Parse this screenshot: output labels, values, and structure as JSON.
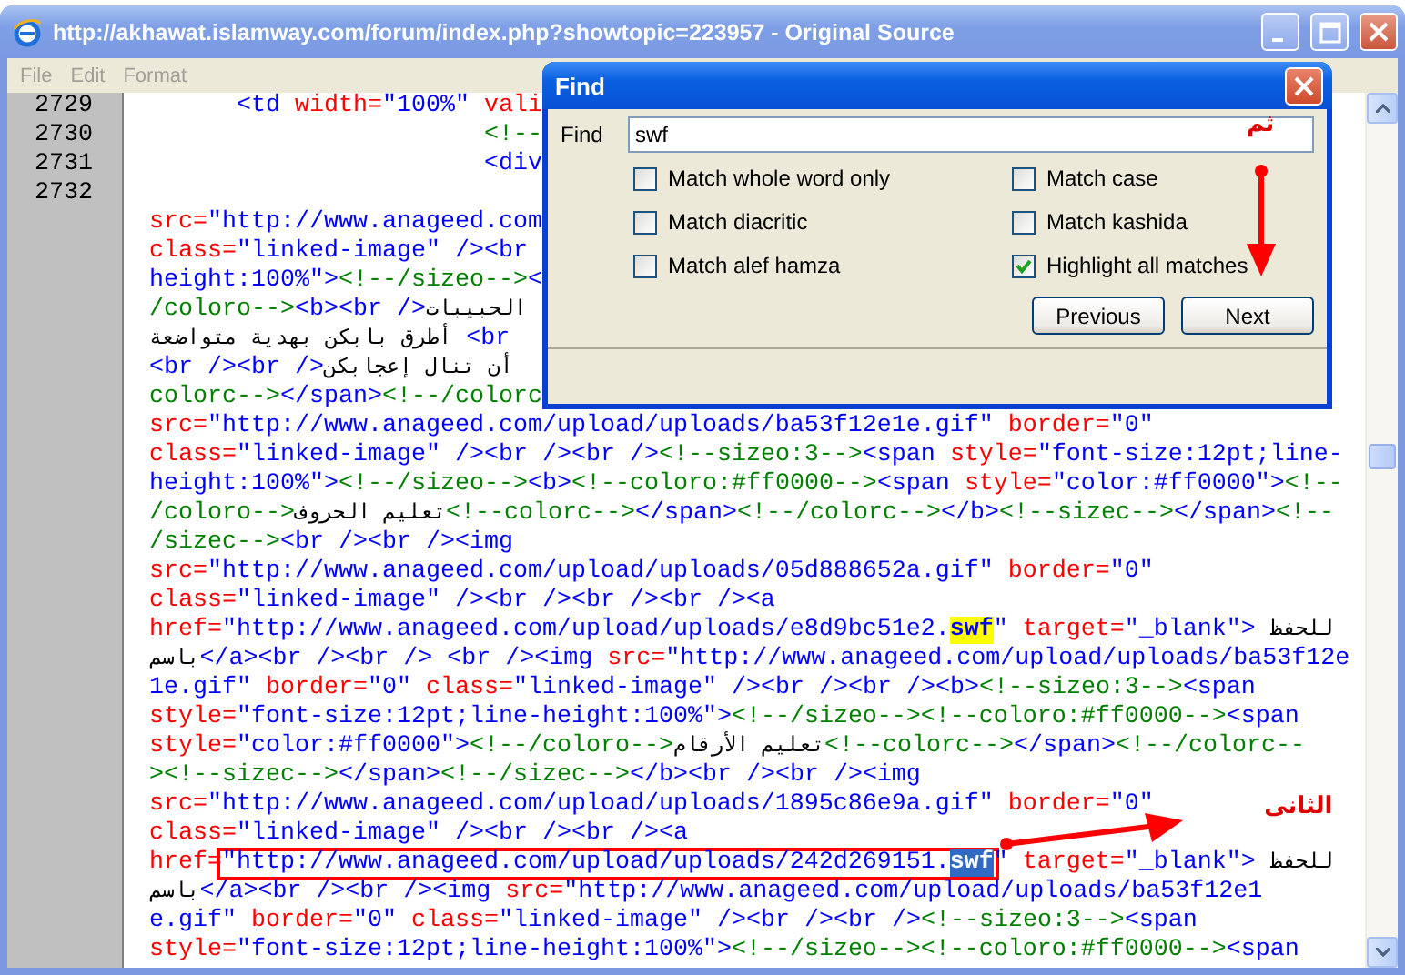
{
  "window": {
    "title": "http://akhawat.islamway.com/forum/index.php?showtopic=223957 - Original Source",
    "menu": [
      "File",
      "Edit",
      "Format"
    ]
  },
  "source": {
    "box_note": "الثانى",
    "lines": [
      {
        "number": "2729",
        "segments": [
          {
            "kind": "markup",
            "text": "      <td "
          },
          {
            "kind": "attr",
            "text": "width="
          },
          {
            "kind": "markup",
            "text": "\"100%\" "
          },
          {
            "kind": "attr",
            "text": "vali"
          }
        ]
      },
      {
        "number": "2730",
        "segments": [
          {
            "kind": "comment",
            "text": "                       <!--"
          }
        ]
      },
      {
        "number": "2731",
        "segments": [
          {
            "kind": "markup",
            "text": "                       <div"
          }
        ]
      },
      {
        "number": "2732"
      },
      {
        "segments": [
          {
            "kind": "attr",
            "text": "src="
          },
          {
            "kind": "markup",
            "text": "\"http://www.anageed.com"
          }
        ]
      },
      {
        "segments": [
          {
            "kind": "attr",
            "text": "class="
          },
          {
            "kind": "markup",
            "text": "\"linked-image\" /><br"
          }
        ]
      },
      {
        "segments": [
          {
            "kind": "markup",
            "text": "height:100%\">"
          },
          {
            "kind": "comment",
            "text": "<!--/sizeo-->"
          },
          {
            "kind": "markup",
            "text": "<"
          }
        ]
      },
      {
        "segments": [
          {
            "kind": "comment",
            "text": "/coloro-->"
          },
          {
            "kind": "markup",
            "text": "<b><br />"
          },
          {
            "kind": "text",
            "text": "الحبيبات"
          }
        ]
      },
      {
        "segments": [
          {
            "kind": "text",
            "text": "أطرق بابكن بهدية متواضعة"
          },
          {
            "kind": "markup",
            "text": " <br"
          }
        ]
      },
      {
        "segments": [
          {
            "kind": "markup",
            "text": "<br /><br />"
          },
          {
            "kind": "text",
            "text": "أن تنال إعجابكن"
          }
        ]
      },
      {
        "segments": [
          {
            "kind": "comment",
            "text": "colorc-->"
          },
          {
            "kind": "markup",
            "text": "</span>"
          },
          {
            "kind": "comment",
            "text": "<!--/colorc"
          }
        ]
      },
      {
        "segments": [
          {
            "kind": "attr",
            "text": "src="
          },
          {
            "kind": "markup",
            "text": "\"http://www.anageed.com/upload/uploads/ba53f12e1e.gif\" "
          },
          {
            "kind": "attr",
            "text": "border="
          },
          {
            "kind": "markup",
            "text": "\"0\""
          }
        ]
      },
      {
        "segments": [
          {
            "kind": "attr",
            "text": "class="
          },
          {
            "kind": "markup",
            "text": "\"linked-image\" /><br /><br />"
          },
          {
            "kind": "comment",
            "text": "<!--sizeo:3-->"
          },
          {
            "kind": "markup",
            "text": "<span "
          },
          {
            "kind": "attr",
            "text": "style="
          },
          {
            "kind": "markup",
            "text": "\"font-size:12pt;line-"
          }
        ]
      },
      {
        "segments": [
          {
            "kind": "markup",
            "text": "height:100%\">"
          },
          {
            "kind": "comment",
            "text": "<!--/sizeo-->"
          },
          {
            "kind": "markup",
            "text": "<b>"
          },
          {
            "kind": "comment",
            "text": "<!--coloro:#ff0000-->"
          },
          {
            "kind": "markup",
            "text": "<span "
          },
          {
            "kind": "attr",
            "text": "style="
          },
          {
            "kind": "markup",
            "text": "\"color:#ff0000\">"
          },
          {
            "kind": "comment",
            "text": "<!--"
          }
        ]
      },
      {
        "segments": [
          {
            "kind": "comment",
            "text": "/coloro-->"
          },
          {
            "kind": "text",
            "text": "تعليم الحروف"
          },
          {
            "kind": "comment",
            "text": "<!--colorc-->"
          },
          {
            "kind": "markup",
            "text": "</span>"
          },
          {
            "kind": "comment",
            "text": "<!--/colorc-->"
          },
          {
            "kind": "markup",
            "text": "</b>"
          },
          {
            "kind": "comment",
            "text": "<!--sizec-->"
          },
          {
            "kind": "markup",
            "text": "</span>"
          },
          {
            "kind": "comment",
            "text": "<!--"
          }
        ]
      },
      {
        "segments": [
          {
            "kind": "comment",
            "text": "/sizec-->"
          },
          {
            "kind": "markup",
            "text": "<br /><br /><img"
          }
        ]
      },
      {
        "segments": [
          {
            "kind": "attr",
            "text": "src="
          },
          {
            "kind": "markup",
            "text": "\"http://www.anageed.com/upload/uploads/05d888652a.gif\" "
          },
          {
            "kind": "attr",
            "text": "border="
          },
          {
            "kind": "markup",
            "text": "\"0\""
          }
        ]
      },
      {
        "segments": [
          {
            "kind": "attr",
            "text": "class="
          },
          {
            "kind": "markup",
            "text": "\"linked-image\" /><br /><br /><br /><a"
          }
        ]
      },
      {
        "segments": [
          {
            "kind": "attr",
            "text": "href="
          },
          {
            "kind": "markup",
            "text": "\"http://www.anageed.com/upload/uploads/e8d9bc51e2."
          },
          {
            "kind": "match",
            "text": "swf"
          },
          {
            "kind": "markup",
            "text": "\" "
          },
          {
            "kind": "attr",
            "text": "target="
          },
          {
            "kind": "markup",
            "text": "\"_blank\"> "
          },
          {
            "kind": "text",
            "text": "للحفظ"
          }
        ]
      },
      {
        "segments": [
          {
            "kind": "text",
            "text": "باسم"
          },
          {
            "kind": "markup",
            "text": "</a><br /><br /> <br /><img "
          },
          {
            "kind": "attr",
            "text": "src="
          },
          {
            "kind": "markup",
            "text": "\"http://www.anageed.com/upload/uploads/ba53f12e"
          }
        ]
      },
      {
        "segments": [
          {
            "kind": "markup",
            "text": "1e.gif\" "
          },
          {
            "kind": "attr",
            "text": "border="
          },
          {
            "kind": "markup",
            "text": "\"0\" "
          },
          {
            "kind": "attr",
            "text": "class="
          },
          {
            "kind": "markup",
            "text": "\"linked-image\" /><br /><br /><b>"
          },
          {
            "kind": "comment",
            "text": "<!--sizeo:3-->"
          },
          {
            "kind": "markup",
            "text": "<span"
          }
        ]
      },
      {
        "segments": [
          {
            "kind": "attr",
            "text": "style="
          },
          {
            "kind": "markup",
            "text": "\"font-size:12pt;line-height:100%\">"
          },
          {
            "kind": "comment",
            "text": "<!--/sizeo--><!--coloro:#ff0000-->"
          },
          {
            "kind": "markup",
            "text": "<span"
          }
        ]
      },
      {
        "segments": [
          {
            "kind": "attr",
            "text": "style="
          },
          {
            "kind": "markup",
            "text": "\"color:#ff0000\">"
          },
          {
            "kind": "comment",
            "text": "<!--/coloro-->"
          },
          {
            "kind": "text",
            "text": "تعليم الأرقام"
          },
          {
            "kind": "comment",
            "text": "<!--colorc-->"
          },
          {
            "kind": "markup",
            "text": "</span>"
          },
          {
            "kind": "comment",
            "text": "<!--/colorc--"
          }
        ]
      },
      {
        "segments": [
          {
            "kind": "comment",
            "text": "><!--sizec-->"
          },
          {
            "kind": "markup",
            "text": "</span>"
          },
          {
            "kind": "comment",
            "text": "<!--/sizec-->"
          },
          {
            "kind": "markup",
            "text": "</b><br /><br /><img"
          }
        ]
      },
      {
        "segments": [
          {
            "kind": "attr",
            "text": "src="
          },
          {
            "kind": "markup",
            "text": "\"http://www.anageed.com/upload/uploads/1895c86e9a.gif\" "
          },
          {
            "kind": "attr",
            "text": "border="
          },
          {
            "kind": "markup",
            "text": "\"0\""
          }
        ]
      },
      {
        "segments": [
          {
            "kind": "attr",
            "text": "class="
          },
          {
            "kind": "markup",
            "text": "\"linked-image\" /><br /><br /><a"
          }
        ]
      },
      {
        "segments": [
          {
            "kind": "attr",
            "text": "href="
          },
          {
            "kind": "markup",
            "text": "\"http://www.anageed.com/upload/uploads/242d269151.",
            "boxed": true
          },
          {
            "kind": "current",
            "text": "swf",
            "boxed": true
          },
          {
            "kind": "markup",
            "text": "\" "
          },
          {
            "kind": "attr",
            "text": "target="
          },
          {
            "kind": "markup",
            "text": "\"_blank\"> "
          },
          {
            "kind": "text",
            "text": "للحفظ"
          }
        ]
      },
      {
        "segments": [
          {
            "kind": "text",
            "text": "باسم"
          },
          {
            "kind": "markup",
            "text": "</a><br /><br /><img "
          },
          {
            "kind": "attr",
            "text": "src="
          },
          {
            "kind": "markup",
            "text": "\"http://www.anageed.com/upload/uploads/ba53f12e1"
          }
        ]
      },
      {
        "segments": [
          {
            "kind": "markup",
            "text": "e.gif\" "
          },
          {
            "kind": "attr",
            "text": "border="
          },
          {
            "kind": "markup",
            "text": "\"0\" "
          },
          {
            "kind": "attr",
            "text": "class="
          },
          {
            "kind": "markup",
            "text": "\"linked-image\" /><br /><br />"
          },
          {
            "kind": "comment",
            "text": "<!--sizeo:3-->"
          },
          {
            "kind": "markup",
            "text": "<span"
          }
        ]
      },
      {
        "segments": [
          {
            "kind": "attr",
            "text": "style="
          },
          {
            "kind": "markup",
            "text": "\"font-size:12pt;line-height:100%\">"
          },
          {
            "kind": "comment",
            "text": "<!--/sizeo--><!--coloro:#ff0000-->"
          },
          {
            "kind": "markup",
            "text": "<span"
          }
        ]
      }
    ]
  },
  "find_dialog": {
    "title": "Find",
    "find_label": "Find",
    "find_value": "swf",
    "note": "ثم",
    "options": [
      {
        "label": "Match whole word only",
        "checked": false
      },
      {
        "label": "Match case",
        "checked": false
      },
      {
        "label": "Match diacritic",
        "checked": false
      },
      {
        "label": "Match kashida",
        "checked": false
      },
      {
        "label": "Match alef hamza",
        "checked": false
      },
      {
        "label": "Highlight all matches",
        "checked": true
      }
    ],
    "buttons": [
      "Previous",
      "Next"
    ]
  }
}
